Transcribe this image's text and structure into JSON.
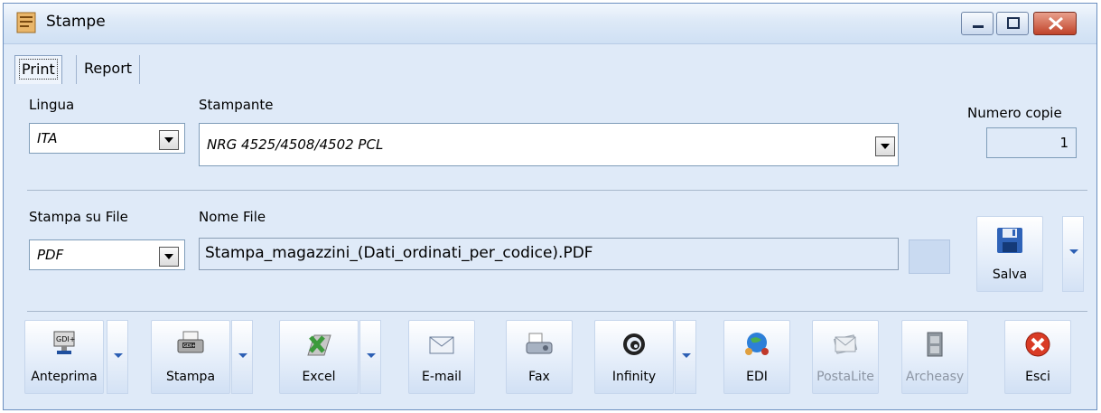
{
  "window": {
    "title": "Stampe",
    "icon": "document-icon"
  },
  "tabs": [
    {
      "label": "Print",
      "active": true
    },
    {
      "label": "Report",
      "active": false
    }
  ],
  "printer": {
    "lingua_label": "Lingua",
    "lingua_value": "ITA",
    "stampante_label": "Stampante",
    "stampante_value": "NRG 4525/4508/4502 PCL",
    "copies_label": "Numero copie",
    "copies_value": "1"
  },
  "file": {
    "stampa_su_file_label": "Stampa su File",
    "stampa_su_file_value": "PDF",
    "nome_file_label": "Nome File",
    "nome_file_value": "Stampa_magazzini_(Dati_ordinati_per_codice).PDF",
    "save_label": "Salva"
  },
  "toolbar": {
    "anteprima": "Anteprima",
    "stampa": "Stampa",
    "excel": "Excel",
    "email": "E-mail",
    "fax": "Fax",
    "infinity": "Infinity",
    "edi": "EDI",
    "postalite": "PostaLite",
    "archeasy": "Archeasy",
    "esci": "Esci"
  },
  "colors": {
    "accent": "#2c5fb4",
    "panel": "#dfeaf8",
    "close": "#c0432a",
    "excel": "#3c9a3c"
  }
}
